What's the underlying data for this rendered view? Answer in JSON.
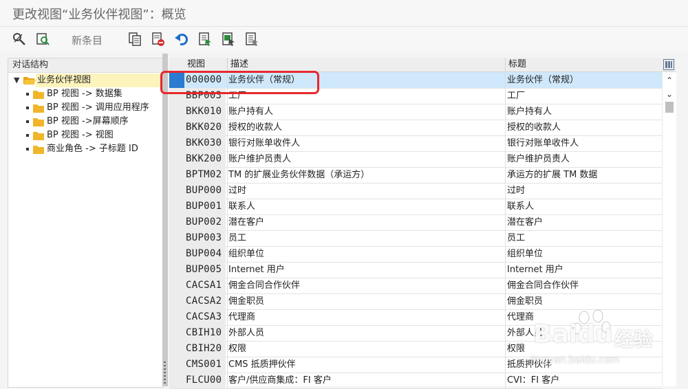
{
  "window": {
    "title": "更改视图“业务伙伴视图”：概览"
  },
  "toolbar": {
    "new_entries_label": "新条目",
    "icons": [
      "display-change-icon",
      "other-view-icon",
      "copy-icon",
      "delete-icon",
      "undo-icon",
      "select-all-icon",
      "select-block-icon",
      "deselect-all-icon"
    ]
  },
  "left_panel": {
    "header": "对话结构",
    "root": {
      "label": "业务伙伴视图",
      "expanded": true
    },
    "items": [
      {
        "label": "BP 视图 -> 数据集"
      },
      {
        "label": "BP 视图 -> 调用应用程序"
      },
      {
        "label": "BP 视图 ->屏幕顺序"
      },
      {
        "label": "BP 视图 -> 视图"
      },
      {
        "label": "商业角色 -> 子标题 ID"
      }
    ]
  },
  "table": {
    "headers": {
      "view": "视图",
      "description": "描述",
      "title": "标题"
    },
    "rows": [
      {
        "view": "000000",
        "desc": "业务伙伴（常规）",
        "title": "业务伙伴（常规）",
        "selected": true
      },
      {
        "view": "BBP003",
        "desc": "工厂",
        "title": "工厂"
      },
      {
        "view": "BKK010",
        "desc": "账户持有人",
        "title": "账户持有人"
      },
      {
        "view": "BKK020",
        "desc": "授权的收款人",
        "title": "授权的收款人"
      },
      {
        "view": "BKK030",
        "desc": "银行对账单收件人",
        "title": "银行对账单收件人"
      },
      {
        "view": "BKK200",
        "desc": "账户维护员责人",
        "title": "账户维护员责人"
      },
      {
        "view": "BPTM02",
        "desc": "TM 的扩展业务伙伴数据（承运方）",
        "title": "承运方的扩展 TM 数据"
      },
      {
        "view": "BUP000",
        "desc": "过时",
        "title": "过时"
      },
      {
        "view": "BUP001",
        "desc": "联系人",
        "title": "联系人"
      },
      {
        "view": "BUP002",
        "desc": "潜在客户",
        "title": "潜在客户"
      },
      {
        "view": "BUP003",
        "desc": "员工",
        "title": "员工"
      },
      {
        "view": "BUP004",
        "desc": "组织单位",
        "title": "组织单位"
      },
      {
        "view": "BUP005",
        "desc": "Internet 用户",
        "title": "Internet 用户"
      },
      {
        "view": "CACSA1",
        "desc": "佣金合同合作伙伴",
        "title": "佣金合同合作伙伴"
      },
      {
        "view": "CACSA2",
        "desc": "佣金职员",
        "title": "佣金职员"
      },
      {
        "view": "CACSA3",
        "desc": "代理商",
        "title": "代理商"
      },
      {
        "view": "CBIH10",
        "desc": "外部人员",
        "title": "外部人员"
      },
      {
        "view": "CBIH20",
        "desc": "权限",
        "title": "权限"
      },
      {
        "view": "CMS001",
        "desc": "CMS 抵质押伙伴",
        "title": "抵质押伙伴"
      },
      {
        "view": "FLCU00",
        "desc": "客户/供应商集成：FI 客户",
        "title": "CVI：FI 客户"
      }
    ]
  },
  "watermark": {
    "brand": "Baidu",
    "brand_suffix": "经验",
    "url": "jingyan.baidu.com"
  },
  "colors": {
    "selected_row": "#cfe8fb",
    "selected_marker": "#2b7bd0",
    "highlight_box": "#e8272d",
    "root_highlight": "#fdf4bd"
  }
}
